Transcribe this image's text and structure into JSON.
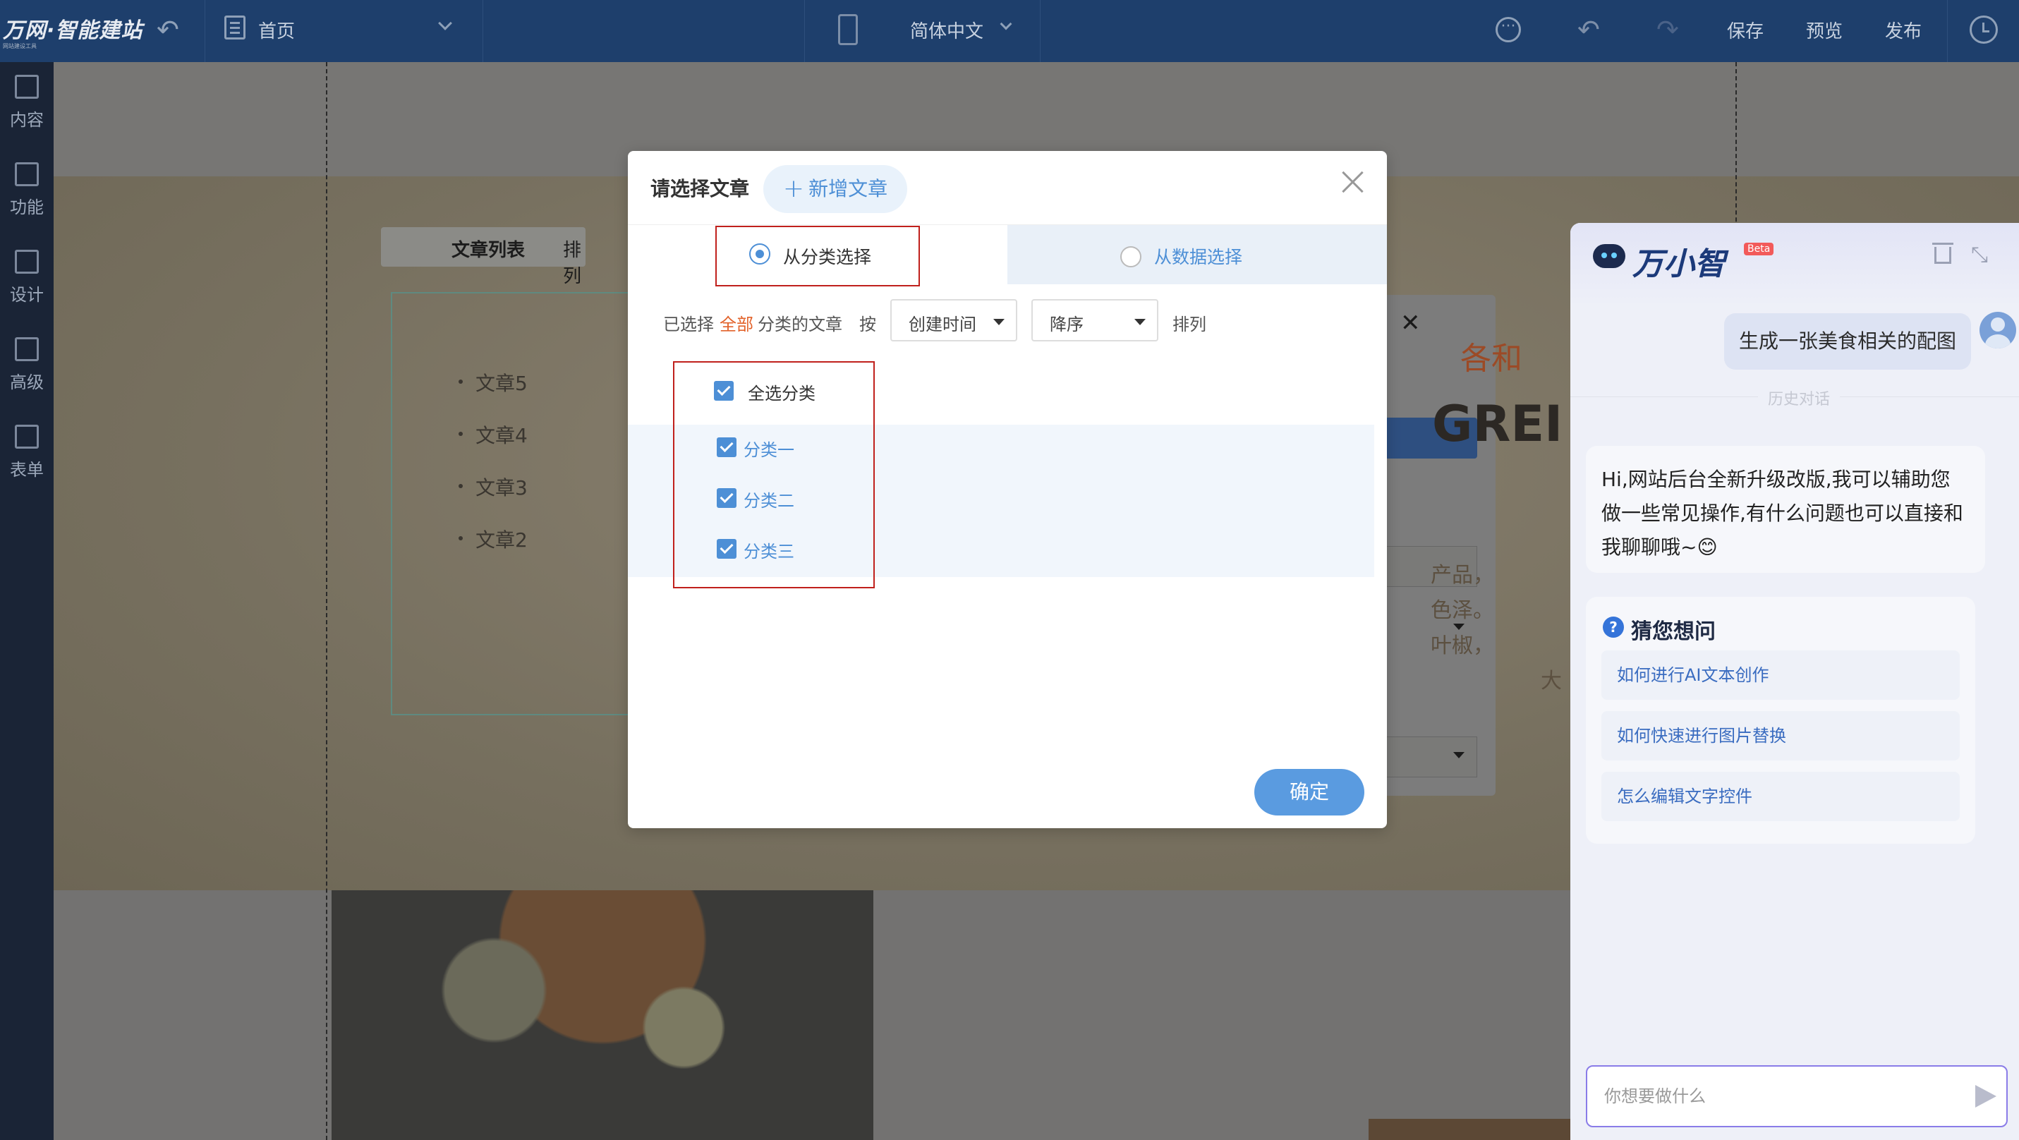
{
  "topbar": {
    "logo": "万网·智能建站",
    "logo_sub": "网站建设工具",
    "page_name": "首页",
    "language": "简体中文",
    "save": "保存",
    "preview": "预览",
    "publish": "发布"
  },
  "sidebar": {
    "items": [
      {
        "label": "内容",
        "icon": "document-icon"
      },
      {
        "label": "功能",
        "icon": "grid-icon"
      },
      {
        "label": "设计",
        "icon": "layout-icon"
      },
      {
        "label": "高级",
        "icon": "code-monitor-icon"
      },
      {
        "label": "表单",
        "icon": "list-icon"
      }
    ]
  },
  "canvas": {
    "article_tabs": [
      "文章列表",
      "排列"
    ],
    "article_list": [
      "文章5",
      "文章4",
      "文章3",
      "文章2"
    ],
    "bg_text_red": "各和",
    "bg_text_big": "GREI",
    "bg_lines": [
      "产品，",
      "色泽。",
      "叶椒，",
      "大"
    ]
  },
  "modal": {
    "title": "请选择文章",
    "add_button": "新增文章",
    "tab_category": "从分类选择",
    "tab_data": "从数据选择",
    "filter": {
      "prefix": "已选择",
      "highlight": "全部",
      "suffix": "分类的文章",
      "by": "按",
      "sort_field": "创建时间",
      "sort_order": "降序",
      "sort_suffix": "排列"
    },
    "select_all": "全选分类",
    "categories": [
      "分类一",
      "分类二",
      "分类三"
    ],
    "confirm": "确定"
  },
  "chat": {
    "brand": "万小智",
    "beta": "Beta",
    "user_message": "生成一张美食相关的配图",
    "history_label": "历史对话",
    "ai_message": "Hi,网站后台全新升级改版,我可以辅助您做一些常见操作,有什么问题也可以直接和我聊聊哦~😊",
    "guess_title": "猜您想问",
    "suggestions": [
      "如何进行AI文本创作",
      "如何快速进行图片替换",
      "怎么编辑文字控件"
    ],
    "input_placeholder": "你想要做什么"
  },
  "colors": {
    "topbar": "#1e3f6c",
    "sidebar": "#1a2436",
    "accent": "#4d8fd6",
    "highlight_orange": "#e2622a",
    "red_outline": "#c0201c"
  }
}
